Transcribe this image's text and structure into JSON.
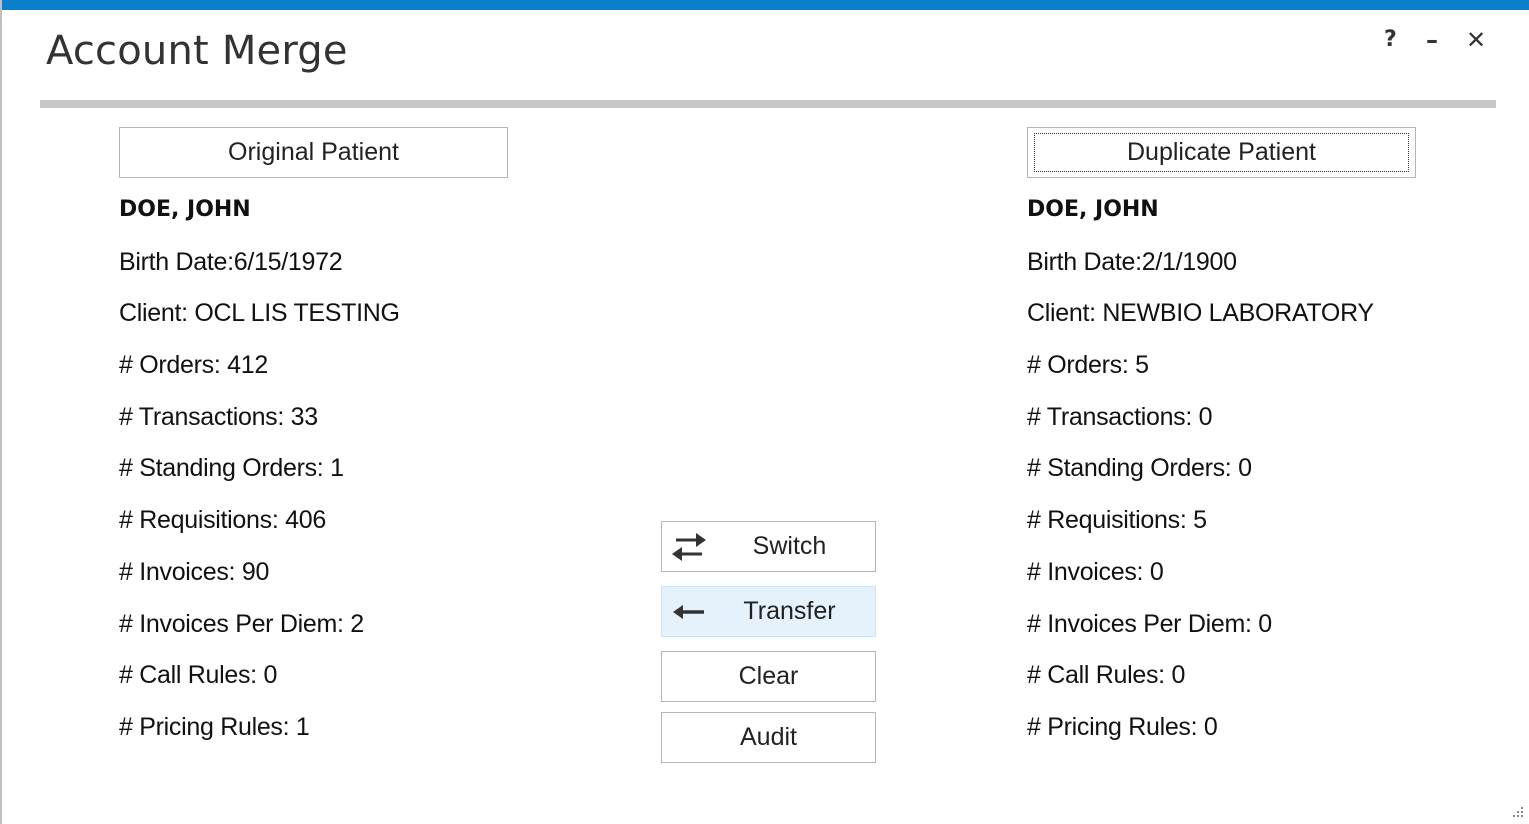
{
  "window": {
    "title": "Account Merge",
    "accent_color": "#0b7fcc",
    "controls": {
      "help": "?",
      "minimize": "–",
      "close": "✕"
    }
  },
  "original": {
    "header_label": "Original Patient",
    "name": "DOE, JOHN",
    "birth_date": "Birth Date:6/15/1972",
    "client": "Client: OCL LIS TESTING",
    "orders": "# Orders: 412",
    "transactions": "# Transactions: 33",
    "standing_orders": "# Standing Orders: 1",
    "requisitions": "# Requisitions: 406",
    "invoices": "# Invoices: 90",
    "invoices_per_diem": "# Invoices Per Diem: 2",
    "call_rules": "# Call Rules: 0",
    "pricing_rules": "# Pricing Rules: 1"
  },
  "duplicate": {
    "header_label": "Duplicate Patient",
    "name": "DOE, JOHN",
    "birth_date": "Birth Date:2/1/1900",
    "client": "Client: NEWBIO LABORATORY",
    "orders": "# Orders: 5",
    "transactions": "# Transactions: 0",
    "standing_orders": "# Standing Orders: 0",
    "requisitions": "# Requisitions: 5",
    "invoices": "# Invoices: 0",
    "invoices_per_diem": "# Invoices Per Diem: 0",
    "call_rules": "# Call Rules: 0",
    "pricing_rules": "# Pricing Rules: 0"
  },
  "actions": {
    "switch": {
      "label": "Switch",
      "icon": "swap-arrows-icon"
    },
    "transfer": {
      "label": "Transfer",
      "icon": "arrow-left-icon"
    },
    "clear": {
      "label": "Clear"
    },
    "audit": {
      "label": "Audit"
    }
  }
}
